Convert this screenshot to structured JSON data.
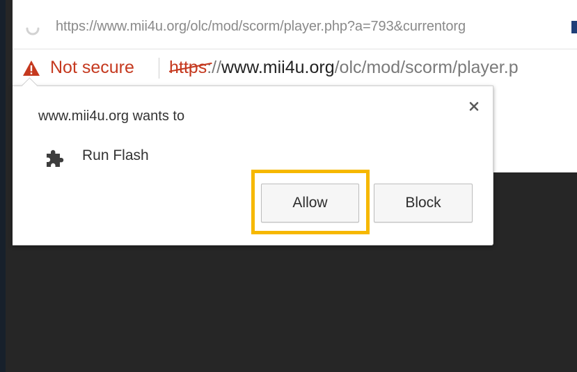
{
  "window": {
    "title_url": "https://www.mii4u.org/olc/mod/scorm/player.php?a=793&currentorg"
  },
  "omnibox": {
    "security_icon": "warning-triangle-icon",
    "security_label": "Not secure",
    "url_scheme": "https",
    "url_separator": "://",
    "url_domain": "www.mii4u.org",
    "url_path": "/olc/mod/scorm/player.p"
  },
  "permission_prompt": {
    "title": "www.mii4u.org wants to",
    "permission_icon": "puzzle-piece-icon",
    "permission_label": "Run Flash",
    "allow_label": "Allow",
    "block_label": "Block",
    "close_icon": "close-icon",
    "highlight_color": "#f6b800"
  },
  "colors": {
    "warning": "#c5391f",
    "page_background": "#262626"
  }
}
